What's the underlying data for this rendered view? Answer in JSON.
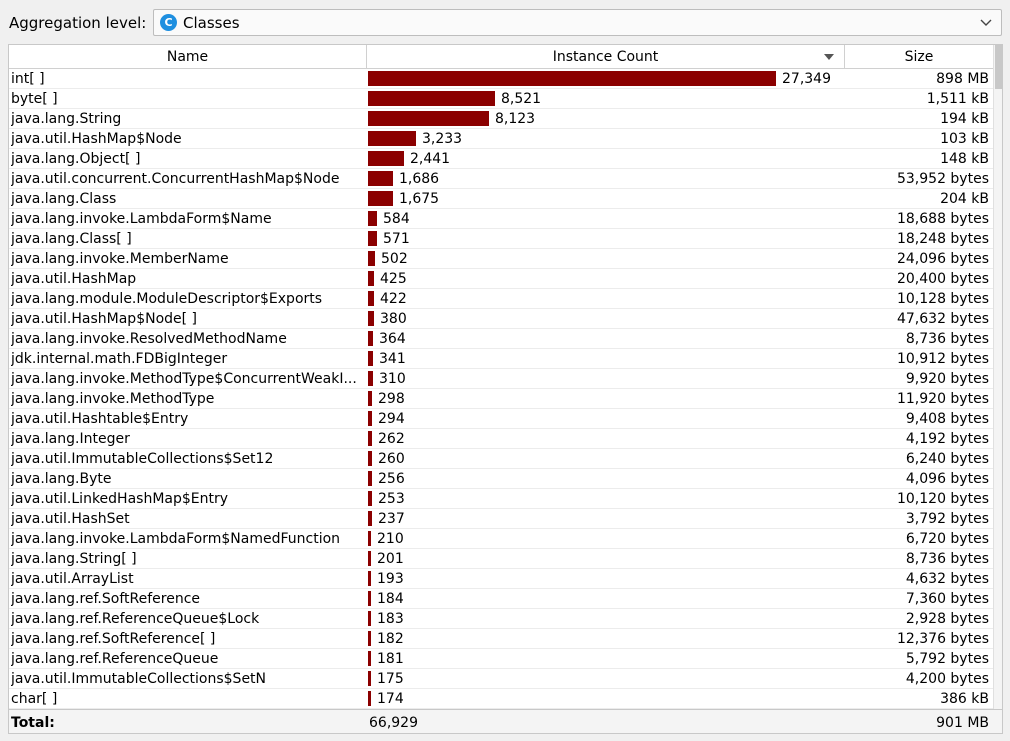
{
  "aggregation": {
    "label": "Aggregation level:",
    "icon_letter": "C",
    "value": "Classes"
  },
  "columns": {
    "name": "Name",
    "count": "Instance Count",
    "size": "Size"
  },
  "rows": [
    {
      "name": "int[ ]",
      "count": 27349,
      "count_label": "27,349",
      "size": "898 MB"
    },
    {
      "name": "byte[ ]",
      "count": 8521,
      "count_label": "8,521",
      "size": "1,511 kB"
    },
    {
      "name": "java.lang.String",
      "count": 8123,
      "count_label": "8,123",
      "size": "194 kB"
    },
    {
      "name": "java.util.HashMap$Node",
      "count": 3233,
      "count_label": "3,233",
      "size": "103 kB"
    },
    {
      "name": "java.lang.Object[ ]",
      "count": 2441,
      "count_label": "2,441",
      "size": "148 kB"
    },
    {
      "name": "java.util.concurrent.ConcurrentHashMap$Node",
      "count": 1686,
      "count_label": "1,686",
      "size": "53,952 bytes"
    },
    {
      "name": "java.lang.Class",
      "count": 1675,
      "count_label": "1,675",
      "size": "204 kB"
    },
    {
      "name": "java.lang.invoke.LambdaForm$Name",
      "count": 584,
      "count_label": "584",
      "size": "18,688 bytes"
    },
    {
      "name": "java.lang.Class[ ]",
      "count": 571,
      "count_label": "571",
      "size": "18,248 bytes"
    },
    {
      "name": "java.lang.invoke.MemberName",
      "count": 502,
      "count_label": "502",
      "size": "24,096 bytes"
    },
    {
      "name": "java.util.HashMap",
      "count": 425,
      "count_label": "425",
      "size": "20,400 bytes"
    },
    {
      "name": "java.lang.module.ModuleDescriptor$Exports",
      "count": 422,
      "count_label": "422",
      "size": "10,128 bytes"
    },
    {
      "name": "java.util.HashMap$Node[ ]",
      "count": 380,
      "count_label": "380",
      "size": "47,632 bytes"
    },
    {
      "name": "java.lang.invoke.ResolvedMethodName",
      "count": 364,
      "count_label": "364",
      "size": "8,736 bytes"
    },
    {
      "name": "jdk.internal.math.FDBigInteger",
      "count": 341,
      "count_label": "341",
      "size": "10,912 bytes"
    },
    {
      "name": "java.lang.invoke.MethodType$ConcurrentWeakI...",
      "count": 310,
      "count_label": "310",
      "size": "9,920 bytes"
    },
    {
      "name": "java.lang.invoke.MethodType",
      "count": 298,
      "count_label": "298",
      "size": "11,920 bytes"
    },
    {
      "name": "java.util.Hashtable$Entry",
      "count": 294,
      "count_label": "294",
      "size": "9,408 bytes"
    },
    {
      "name": "java.lang.Integer",
      "count": 262,
      "count_label": "262",
      "size": "4,192 bytes"
    },
    {
      "name": "java.util.ImmutableCollections$Set12",
      "count": 260,
      "count_label": "260",
      "size": "6,240 bytes"
    },
    {
      "name": "java.lang.Byte",
      "count": 256,
      "count_label": "256",
      "size": "4,096 bytes"
    },
    {
      "name": "java.util.LinkedHashMap$Entry",
      "count": 253,
      "count_label": "253",
      "size": "10,120 bytes"
    },
    {
      "name": "java.util.HashSet",
      "count": 237,
      "count_label": "237",
      "size": "3,792 bytes"
    },
    {
      "name": "java.lang.invoke.LambdaForm$NamedFunction",
      "count": 210,
      "count_label": "210",
      "size": "6,720 bytes"
    },
    {
      "name": "java.lang.String[ ]",
      "count": 201,
      "count_label": "201",
      "size": "8,736 bytes"
    },
    {
      "name": "java.util.ArrayList",
      "count": 193,
      "count_label": "193",
      "size": "4,632 bytes"
    },
    {
      "name": "java.lang.ref.SoftReference",
      "count": 184,
      "count_label": "184",
      "size": "7,360 bytes"
    },
    {
      "name": "java.lang.ref.ReferenceQueue$Lock",
      "count": 183,
      "count_label": "183",
      "size": "2,928 bytes"
    },
    {
      "name": "java.lang.ref.SoftReference[ ]",
      "count": 182,
      "count_label": "182",
      "size": "12,376 bytes"
    },
    {
      "name": "java.lang.ref.ReferenceQueue",
      "count": 181,
      "count_label": "181",
      "size": "5,792 bytes"
    },
    {
      "name": "java.util.ImmutableCollections$SetN",
      "count": 175,
      "count_label": "175",
      "size": "4,200 bytes"
    },
    {
      "name": "char[ ]",
      "count": 174,
      "count_label": "174",
      "size": "386 kB"
    }
  ],
  "footer": {
    "label": "Total:",
    "count": "66,929",
    "size": "901 MB"
  },
  "colors": {
    "bar": "#8b0000",
    "icon": "#1e8fe0"
  }
}
